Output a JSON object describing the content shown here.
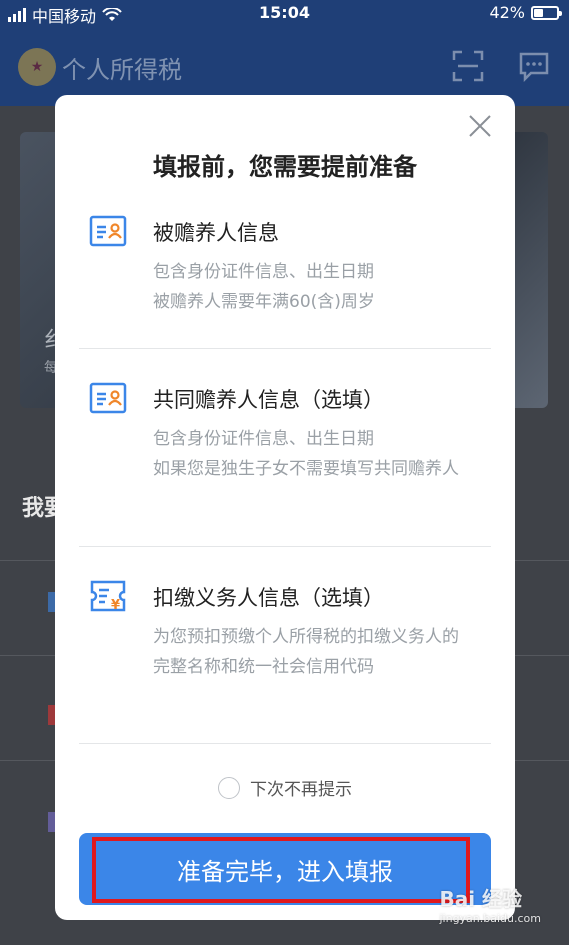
{
  "status_bar": {
    "carrier": "中国移动",
    "time": "15:04",
    "battery": "42%",
    "battery_level": 0.42
  },
  "app": {
    "title": "个人所得税",
    "banner_text_1": "纟",
    "banner_text_2": "每",
    "section_title": "我要"
  },
  "modal": {
    "title": "填报前，您需要提前准备",
    "sections": [
      {
        "icon": "id-card-icon",
        "title": "被赡养人信息",
        "desc": "包含身份证件信息、出生日期\n被赡养人需要年满60(含)周岁"
      },
      {
        "icon": "id-card-icon",
        "title": "共同赡养人信息（选填）",
        "desc": "包含身份证件信息、出生日期\n如果您是独生子女不需要填写共同赡养人"
      },
      {
        "icon": "receipt-yuan-icon",
        "title": "扣缴义务人信息（选填）",
        "desc": "为您预扣预缴个人所得税的扣缴义务人的完整名称和统一社会信用代码"
      }
    ],
    "checkbox_label": "下次不再提示",
    "primary_button": "准备完毕，进入填报"
  },
  "watermark": {
    "brand": "Bai 经验",
    "url": "jingyan.baidu.com"
  },
  "colors": {
    "accent": "#3b86e8",
    "highlight": "#e0191d",
    "icon_blue": "#3b86e8",
    "icon_orange": "#f0862a"
  }
}
